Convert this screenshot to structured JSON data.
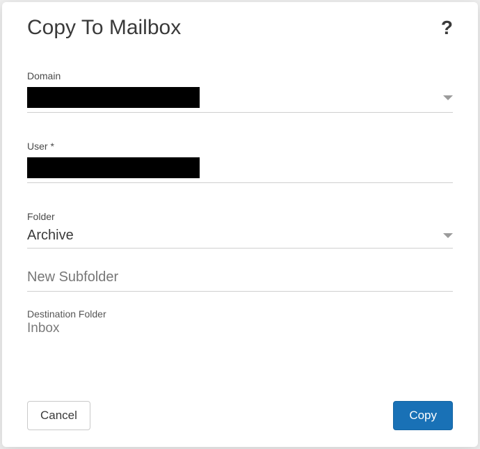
{
  "title": "Copy To Mailbox",
  "help": "?",
  "fields": {
    "domain": {
      "label": "Domain",
      "value": ""
    },
    "user": {
      "label": "User *",
      "value": ""
    },
    "folder": {
      "label": "Folder",
      "value": "Archive"
    },
    "new_subfolder": {
      "placeholder": "New Subfolder",
      "value": ""
    },
    "destination": {
      "label": "Destination Folder",
      "value": "Inbox"
    }
  },
  "buttons": {
    "cancel": "Cancel",
    "copy": "Copy"
  }
}
